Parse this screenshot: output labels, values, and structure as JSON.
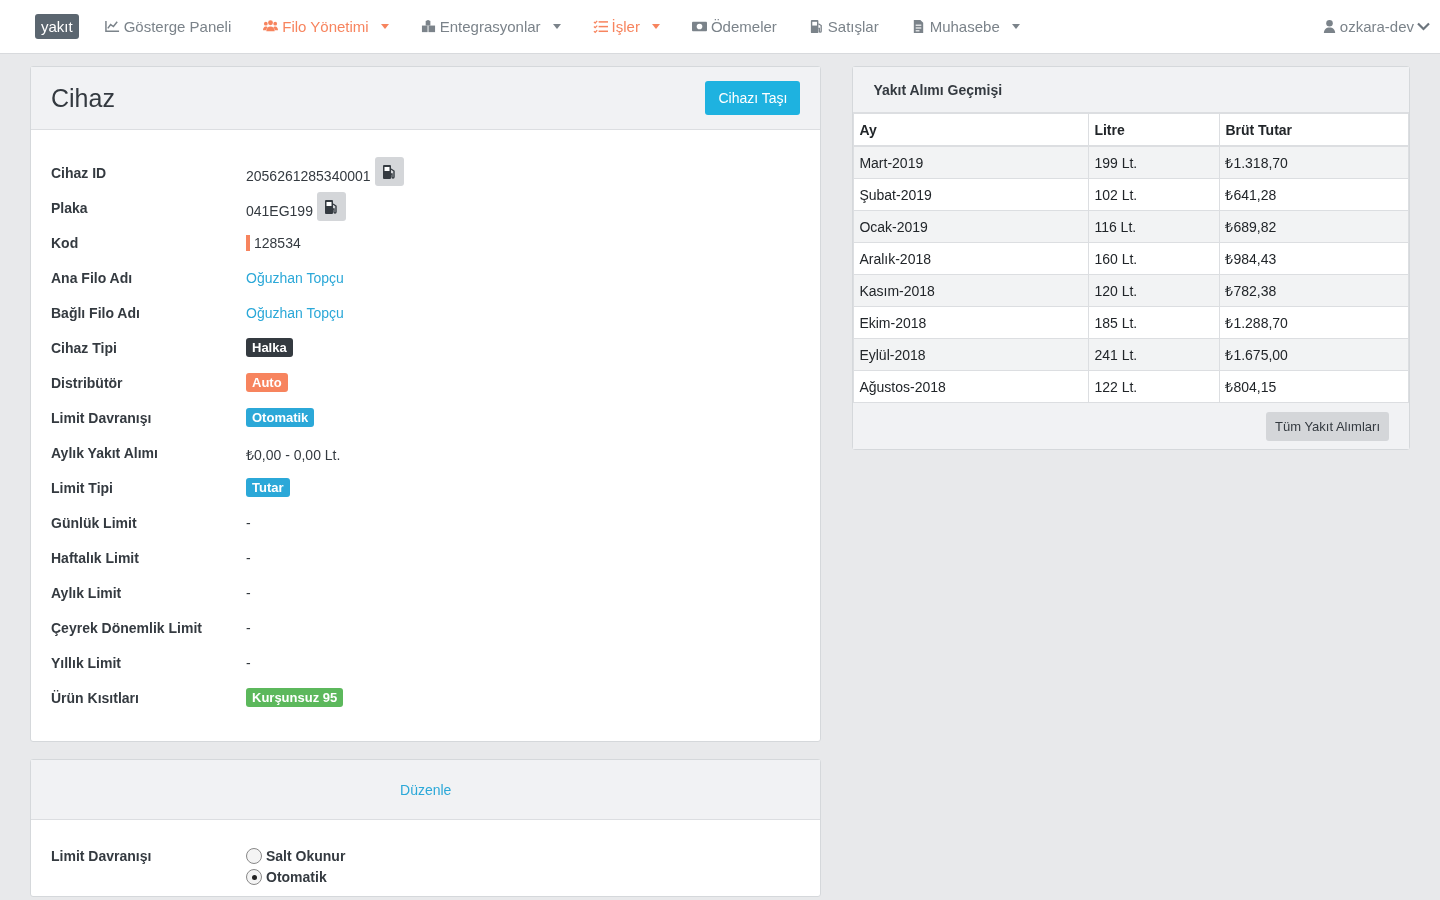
{
  "navbar": {
    "brand": "yakıt",
    "items": [
      {
        "label": "Gösterge Paneli",
        "dropdown": false,
        "selected": false
      },
      {
        "label": "Filo Yönetimi",
        "dropdown": true,
        "selected": true
      },
      {
        "label": "Entegrasyonlar",
        "dropdown": true,
        "selected": false
      },
      {
        "label": "İşler",
        "dropdown": true,
        "selected": true
      },
      {
        "label": "Ödemeler",
        "dropdown": false,
        "selected": false
      },
      {
        "label": "Satışlar",
        "dropdown": false,
        "selected": false
      },
      {
        "label": "Muhasebe",
        "dropdown": true,
        "selected": false
      }
    ],
    "user": "ozkara-dev"
  },
  "device_card": {
    "title": "Cihaz",
    "action": "Cihazı Taşı",
    "rows": [
      {
        "label": "Cihaz ID",
        "kind": "text_button",
        "value": "2056261285340001"
      },
      {
        "label": "Plaka",
        "kind": "text_button",
        "value": "041EG199"
      },
      {
        "label": "Kod",
        "kind": "marked",
        "value": "128534",
        "color": "#f7845e"
      },
      {
        "label": "Ana Filo Adı",
        "kind": "link",
        "value": "Oğuzhan Topçu"
      },
      {
        "label": "Bağlı Filo Adı",
        "kind": "link",
        "value": "Oğuzhan Topçu"
      },
      {
        "label": "Cihaz Tipi",
        "kind": "badge",
        "value": "Halka",
        "color": "#343a40"
      },
      {
        "label": "Distribütör",
        "kind": "badge",
        "value": "Auto",
        "color": "#f7845e"
      },
      {
        "label": "Limit Davranışı",
        "kind": "badge",
        "value": "Otomatik",
        "color": "#2ba8d8"
      },
      {
        "label": "Aylık Yakıt Alımı",
        "kind": "text",
        "value": "₺0,00 - 0,00 Lt."
      },
      {
        "label": "Limit Tipi",
        "kind": "badge",
        "value": "Tutar",
        "color": "#2ba8d8"
      },
      {
        "label": "Günlük Limit",
        "kind": "text",
        "value": "-"
      },
      {
        "label": "Haftalık Limit",
        "kind": "text",
        "value": "-"
      },
      {
        "label": "Aylık Limit",
        "kind": "text",
        "value": "-"
      },
      {
        "label": "Çeyrek Dönemlik Limit",
        "kind": "text",
        "value": "-"
      },
      {
        "label": "Yıllık Limit",
        "kind": "text",
        "value": "-"
      },
      {
        "label": "Ürün Kısıtları",
        "kind": "badge",
        "value": "Kurşunsuz 95",
        "color": "#5cb85c"
      }
    ]
  },
  "edit_card": {
    "title": "Düzenle",
    "field_label": "Limit Davranışı",
    "options": [
      {
        "label": "Salt Okunur",
        "selected": false
      },
      {
        "label": "Otomatik",
        "selected": true
      }
    ]
  },
  "history": {
    "title": "Yakıt Alımı Geçmişi",
    "columns": [
      "Ay",
      "Litre",
      "Brüt Tutar"
    ],
    "rows": [
      [
        "Mart-2019",
        "199 Lt.",
        "₺1.318,70"
      ],
      [
        "Şubat-2019",
        "102 Lt.",
        "₺641,28"
      ],
      [
        "Ocak-2019",
        "116 Lt.",
        "₺689,82"
      ],
      [
        "Aralık-2018",
        "160 Lt.",
        "₺984,43"
      ],
      [
        "Kasım-2018",
        "120 Lt.",
        "₺782,38"
      ],
      [
        "Ekim-2018",
        "185 Lt.",
        "₺1.288,70"
      ],
      [
        "Eylül-2018",
        "241 Lt.",
        "₺1.675,00"
      ],
      [
        "Ağustos-2018",
        "122 Lt.",
        "₺804,15"
      ]
    ],
    "button": "Tüm Yakıt Alımları"
  }
}
